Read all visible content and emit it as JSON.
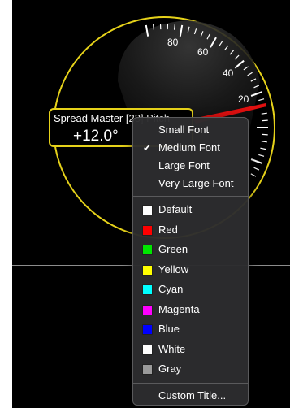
{
  "gauge": {
    "tick_labels": [
      "80",
      "60",
      "40",
      "20"
    ],
    "colors": {
      "ring": "#e6d21a",
      "needle": "#e01010",
      "face": "#1a1a1a"
    }
  },
  "readout": {
    "title": "Spread Master [23] Pitch",
    "value": "+12.0°"
  },
  "context_menu": {
    "font_items": [
      {
        "label": "Small Font",
        "checked": false
      },
      {
        "label": "Medium Font",
        "checked": true
      },
      {
        "label": "Large Font",
        "checked": false
      },
      {
        "label": "Very Large Font",
        "checked": false
      }
    ],
    "check_mark": "✔",
    "color_items": [
      {
        "label": "Default",
        "swatch": "#ffffff"
      },
      {
        "label": "Red",
        "swatch": "#ff0000"
      },
      {
        "label": "Green",
        "swatch": "#00e600"
      },
      {
        "label": "Yellow",
        "swatch": "#ffff00"
      },
      {
        "label": "Cyan",
        "swatch": "#00ffff"
      },
      {
        "label": "Magenta",
        "swatch": "#ff00ff"
      },
      {
        "label": "Blue",
        "swatch": "#0000ff"
      },
      {
        "label": "White",
        "swatch": "#ffffff"
      },
      {
        "label": "Gray",
        "swatch": "#9a9a9a"
      }
    ],
    "custom_title": "Custom Title..."
  }
}
